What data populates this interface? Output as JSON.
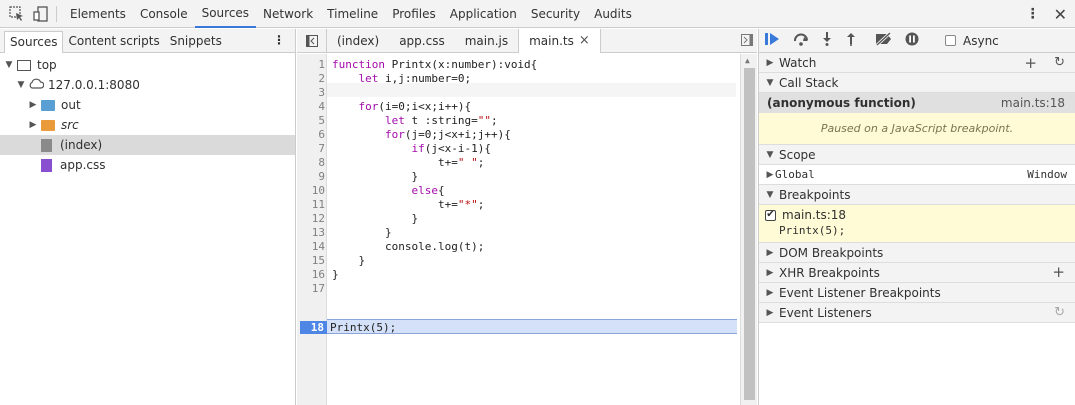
{
  "toolbar": {
    "tabs": [
      "Elements",
      "Console",
      "Sources",
      "Network",
      "Timeline",
      "Profiles",
      "Application",
      "Security",
      "Audits"
    ],
    "active_tab": "Sources"
  },
  "navigator": {
    "tabs": [
      "Sources",
      "Content scripts",
      "Snippets"
    ],
    "tree": [
      {
        "label": "top"
      },
      {
        "label": "127.0.0.1:8080"
      },
      {
        "label": "out"
      },
      {
        "label": "src"
      },
      {
        "label": "(index)"
      },
      {
        "label": "app.css"
      }
    ]
  },
  "editor": {
    "tabs": [
      "(index)",
      "app.css",
      "main.js",
      "main.ts"
    ],
    "close_glyph": "×",
    "breakpoint_line": "18",
    "lines": [
      {
        "n": "1",
        "t": "function Printx(x:number):void{"
      },
      {
        "n": "2",
        "t": "    let i,j:number=0;"
      },
      {
        "n": "3",
        "t": ""
      },
      {
        "n": "4",
        "t": "    for(i=0;i<x;i++){"
      },
      {
        "n": "5",
        "t": "        let t :string=\"\";"
      },
      {
        "n": "6",
        "t": "        for(j=0;j<x+i;j++){"
      },
      {
        "n": "7",
        "t": "            if(j<x-i-1){"
      },
      {
        "n": "8",
        "t": "                t+=\" \";"
      },
      {
        "n": "9",
        "t": "            }"
      },
      {
        "n": "10",
        "t": "            else{"
      },
      {
        "n": "11",
        "t": "                t+=\"*\";"
      },
      {
        "n": "12",
        "t": "            }"
      },
      {
        "n": "13",
        "t": "        }"
      },
      {
        "n": "14",
        "t": "        console.log(t);"
      },
      {
        "n": "15",
        "t": "    }"
      },
      {
        "n": "16",
        "t": "}"
      },
      {
        "n": "17",
        "t": ""
      },
      {
        "n": "18",
        "t": "Printx(5);"
      }
    ]
  },
  "debugger": {
    "async_label": "Async",
    "watch": "Watch",
    "call_stack": "Call Stack",
    "frame_name": "(anonymous function)",
    "frame_loc": "main.ts:18",
    "paused_msg": "Paused on a JavaScript breakpoint.",
    "scope": "Scope",
    "global_label": "Global",
    "global_value": "Window",
    "breakpoints": "Breakpoints",
    "bp_file": "main.ts:18",
    "bp_code": "Printx(5);",
    "dom_bp": "DOM Breakpoints",
    "xhr_bp": "XHR Breakpoints",
    "event_bp": "Event Listener Breakpoints",
    "event_listeners": "Event Listeners"
  }
}
